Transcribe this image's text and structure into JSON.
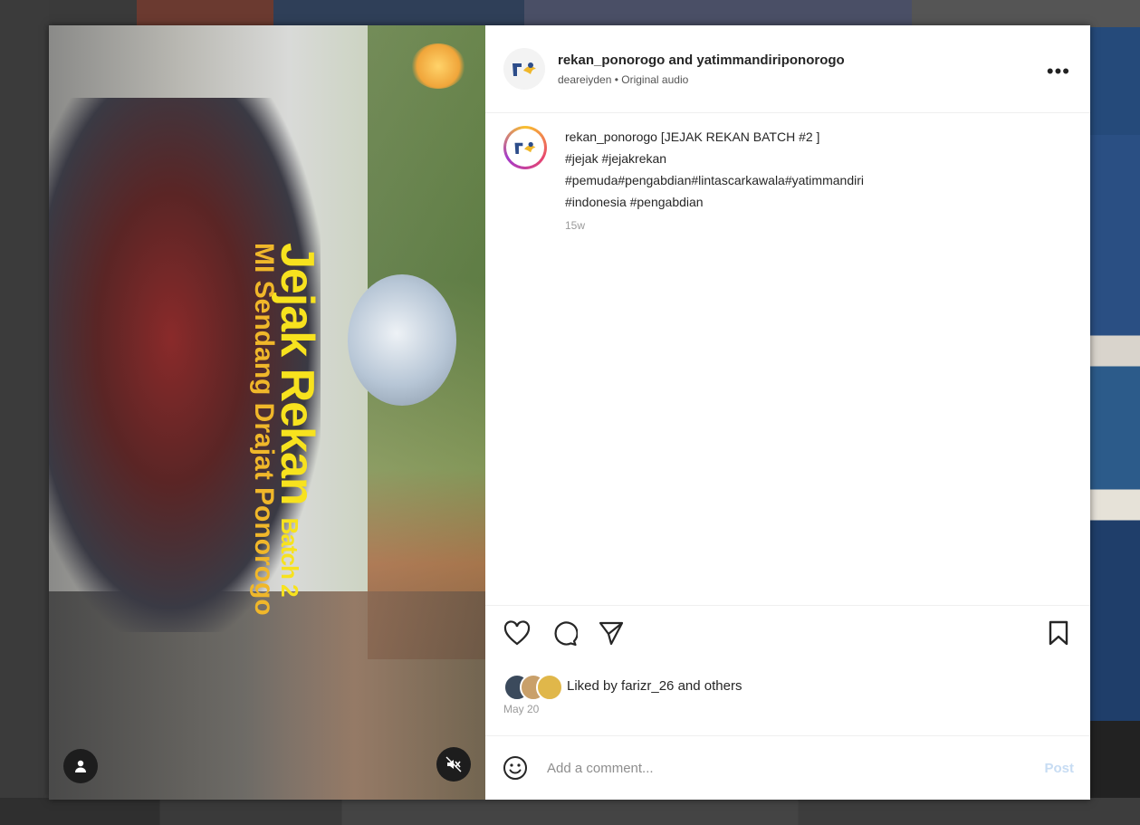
{
  "post": {
    "header": {
      "title": "rekan_ponorogo and yatimmandiriponorogo",
      "subtitle": "deareiyden • Original audio",
      "more_label": "•••"
    },
    "media": {
      "overlay_title": "Jejak Rekan",
      "overlay_batch": "Batch 2",
      "overlay_location": "MI Sendang Drajat Ponorogo",
      "left_button_icon": "user-icon",
      "right_button_icon": "muted-speaker-icon"
    },
    "caption": {
      "username": "rekan_ponorogo",
      "text_line1": "[JEJAK REKAN BATCH #2 ]",
      "text_line2": "#jejak #jejakrekan",
      "text_line3": "#pemuda#pengabdian#lintascarkawala#yatimmandiri",
      "text_line4": "#indonesia #pengabdian",
      "time": "15w"
    },
    "actions": {
      "like_icon": "heart-icon",
      "comment_icon": "comment-icon",
      "share_icon": "send-icon",
      "save_icon": "bookmark-icon"
    },
    "likes": {
      "text": "Liked by farizr_26 and others"
    },
    "date": "May 20",
    "comment_box": {
      "emoji_icon": "smiley-icon",
      "placeholder": "Add a comment...",
      "post_label": "Post"
    }
  },
  "colors": {
    "overlay_yellow": "#f7e21e",
    "overlay_orange": "#f0b72a",
    "text_primary": "#262626",
    "text_secondary": "#9a9a9a",
    "post_button": "#c7dcf3"
  }
}
